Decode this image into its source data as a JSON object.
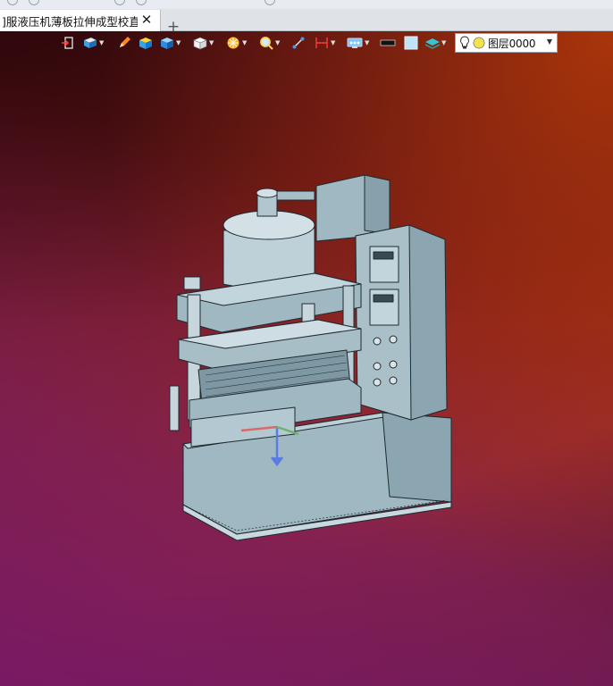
{
  "tab": {
    "title": "]服液压机薄板拉伸成型校直]",
    "close_glyph": "✕",
    "add_glyph": "+"
  },
  "toolbar": {
    "layer_label": "图层0000",
    "icons": [
      "exit-icon",
      "display-mode-icon",
      "sketch-pencil-icon",
      "box-solid-icon",
      "cube-blue-icon",
      "cube-white-icon",
      "render-style-icon",
      "zoom-view-icon",
      "view-align-icon",
      "dimension-icon",
      "view-orient-icon",
      "line-color-icon",
      "fill-color-icon",
      "layer-stack-icon",
      "bulb-icon",
      "layer-color-icon"
    ]
  },
  "colors": {
    "model_fill": "#9fb8c2",
    "model_edge": "#1e2a30",
    "accent_blue": "#3aa0e8"
  }
}
